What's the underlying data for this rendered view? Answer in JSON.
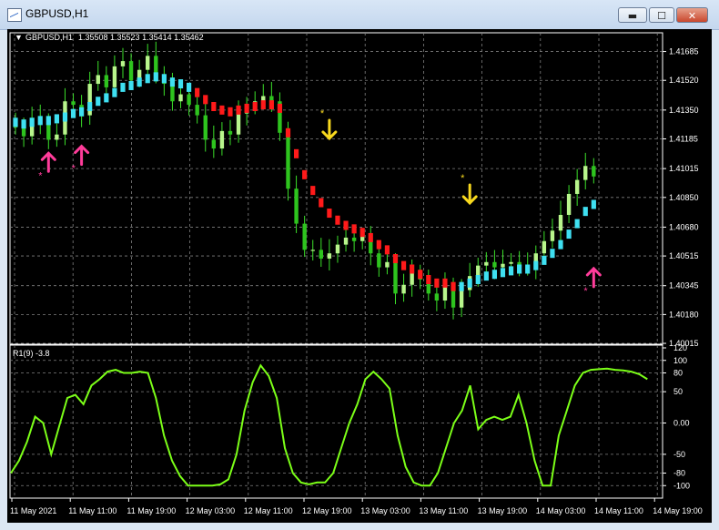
{
  "window": {
    "title": "GBPUSD,H1",
    "min_label": "▬",
    "max_label": "☐",
    "close_label": "✕"
  },
  "chart_header": {
    "symbol": "GBPUSD,H1",
    "ohlc": "1.35508 1.35523 1.35414 1.35462"
  },
  "oscillator_header": "R1(9) -3.8",
  "colors": {
    "bull": "#b8f58c",
    "bear": "#2ec41e",
    "wick": "#3be02a",
    "ma_up": "#3fe0f2",
    "ma_down": "#ff1a1a",
    "buy_arrow": "#ff3c9a",
    "sell_arrow": "#f7d81e",
    "oscillator": "#7cff18",
    "grid": "#808080"
  },
  "chart_data": [
    {
      "type": "candlestick",
      "title": "GBPUSD,H1",
      "ylim": [
        1.4001,
        1.4174
      ],
      "price_ticks": [
        "1.41685",
        "1.41520",
        "1.41350",
        "1.41185",
        "1.41015",
        "1.40850",
        "1.40680",
        "1.40515",
        "1.40345",
        "1.40180",
        "1.40015"
      ],
      "x_labels": [
        "11 May 2021",
        "11 May 11:00",
        "11 May 19:00",
        "12 May 03:00",
        "12 May 11:00",
        "12 May 19:00",
        "13 May 03:00",
        "13 May 11:00",
        "13 May 19:00",
        "14 May 03:00",
        "14 May 11:00",
        "14 May 19:00"
      ],
      "closes": [
        1.4125,
        1.412,
        1.413,
        1.4128,
        1.4118,
        1.4121,
        1.414,
        1.4138,
        1.4132,
        1.415,
        1.4155,
        1.4148,
        1.416,
        1.4163,
        1.4152,
        1.4158,
        1.4166,
        1.4155,
        1.415,
        1.414,
        1.4144,
        1.4138,
        1.4132,
        1.4118,
        1.4113,
        1.4123,
        1.4121,
        1.4133,
        1.4138,
        1.414,
        1.4143,
        1.414,
        1.4122,
        1.409,
        1.407,
        1.4055,
        1.4055,
        1.405,
        1.4053,
        1.4058,
        1.4062,
        1.406,
        1.4063,
        1.4053,
        1.4045,
        1.4048,
        1.403,
        1.4035,
        1.4042,
        1.4038,
        1.403,
        1.4026,
        1.4034,
        1.4022,
        1.4032,
        1.404,
        1.4046,
        1.4048,
        1.4045,
        1.4047,
        1.4048,
        1.4046,
        1.4045,
        1.4053,
        1.406,
        1.4066,
        1.4075,
        1.4087,
        1.4095,
        1.4103,
        1.4097
      ],
      "ma_points": [
        1.4128,
        1.4127,
        1.4128,
        1.4129,
        1.4129,
        1.413,
        1.4131,
        1.4133,
        1.4134,
        1.4137,
        1.414,
        1.4142,
        1.4145,
        1.4148,
        1.4149,
        1.4151,
        1.4153,
        1.4154,
        1.4153,
        1.4151,
        1.415,
        1.4148,
        1.4145,
        1.4141,
        1.4137,
        1.4135,
        1.4134,
        1.4135,
        1.4136,
        1.4137,
        1.4138,
        1.4138,
        1.4136,
        1.4122,
        1.411,
        1.4098,
        1.4089,
        1.4082,
        1.4076,
        1.4072,
        1.4069,
        1.4067,
        1.4065,
        1.4062,
        1.4058,
        1.4055,
        1.405,
        1.4046,
        1.4044,
        1.4041,
        1.4038,
        1.4036,
        1.4036,
        1.4034,
        1.4034,
        1.4036,
        1.4038,
        1.404,
        1.4041,
        1.4042,
        1.4043,
        1.4044,
        1.4044,
        1.4046,
        1.4049,
        1.4053,
        1.4058,
        1.4064,
        1.407,
        1.4077,
        1.4081
      ],
      "ma_direction": [
        "up",
        "up",
        "up",
        "up",
        "up",
        "up",
        "up",
        "up",
        "up",
        "up",
        "up",
        "up",
        "up",
        "up",
        "up",
        "up",
        "up",
        "up",
        "up",
        "up",
        "up",
        "up",
        "down",
        "down",
        "down",
        "down",
        "down",
        "down",
        "down",
        "down",
        "down",
        "down",
        "down",
        "down",
        "down",
        "down",
        "down",
        "down",
        "down",
        "down",
        "down",
        "down",
        "down",
        "down",
        "down",
        "down",
        "down",
        "down",
        "down",
        "down",
        "down",
        "down",
        "down",
        "down",
        "up",
        "up",
        "up",
        "up",
        "up",
        "up",
        "up",
        "up",
        "up",
        "up",
        "up",
        "up",
        "up",
        "up",
        "up",
        "up",
        "up"
      ],
      "signals": [
        {
          "type": "buy",
          "index": 4,
          "price": 1.4103
        },
        {
          "type": "buy",
          "index": 8,
          "price": 1.4107
        },
        {
          "type": "sell",
          "index": 38,
          "price": 1.4124
        },
        {
          "type": "sell",
          "index": 55,
          "price": 1.4087
        },
        {
          "type": "buy",
          "index": 77,
          "price": 1.4037
        }
      ]
    },
    {
      "type": "line",
      "title": "R1(9) -3.8",
      "ylim": [
        -120,
        120
      ],
      "y_ticks": [
        "120",
        "100",
        "80",
        "50",
        "0.00",
        "-50",
        "-80",
        "-100"
      ],
      "values": [
        -80,
        -60,
        -30,
        10,
        0,
        -50,
        -5,
        40,
        45,
        30,
        60,
        70,
        82,
        85,
        80,
        80,
        82,
        80,
        40,
        -20,
        -60,
        -85,
        -100,
        -100,
        -100,
        -100,
        -98,
        -90,
        -50,
        20,
        65,
        92,
        75,
        40,
        -40,
        -80,
        -95,
        -98,
        -95,
        -95,
        -80,
        -40,
        0,
        30,
        70,
        82,
        70,
        55,
        -20,
        -70,
        -95,
        -100,
        -100,
        -80,
        -40,
        0,
        20,
        60,
        -10,
        5,
        10,
        5,
        10,
        45,
        0,
        -60,
        -100,
        -100,
        -20,
        20,
        60,
        80,
        85,
        86,
        87,
        85,
        84,
        82,
        78,
        70
      ]
    }
  ]
}
